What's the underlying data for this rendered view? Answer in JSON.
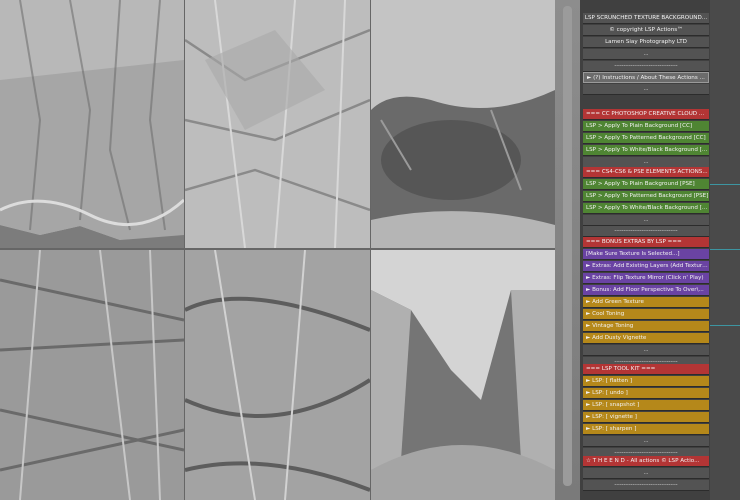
{
  "panel_rows": [
    {
      "text": "LSP SCRUNCHED TEXTURE BACKGROUND...",
      "style": "text"
    },
    {
      "text": "© copyright LSP Actions™",
      "style": "text"
    },
    {
      "text": "Lamen Siay Photography LTD",
      "style": "text"
    },
    {
      "text": "...",
      "style": "dim"
    },
    {
      "text": "-----------------------------------",
      "style": "dim"
    },
    {
      "text": "► (?) Instructions / About These Actions ...",
      "style": "sel"
    },
    {
      "text": "...",
      "style": "dim"
    },
    {
      "text": "=== CC PHOTOSHOP CREATIVE CLOUD ...",
      "style": "red"
    },
    {
      "text": "LSP > Apply To Plain Background [CC]",
      "style": "green"
    },
    {
      "text": "LSP > Apply To Patterned Background [CC]",
      "style": "green"
    },
    {
      "text": "LSP > Apply To White/Black Background [...",
      "style": "green"
    },
    {
      "text": "...",
      "style": "dim"
    },
    {
      "text": "=== CS4-CS6 & PSE ELEMENTS ACTIONS...",
      "style": "red"
    },
    {
      "text": "LSP > Apply To Plain Background [PSE]",
      "style": "green"
    },
    {
      "text": "LSP > Apply To Patterned Background [PSE]",
      "style": "green"
    },
    {
      "text": "LSP > Apply To White/Black Background [...",
      "style": "green"
    },
    {
      "text": "...",
      "style": "dim"
    },
    {
      "text": "-----------------------------------",
      "style": "dim"
    },
    {
      "text": "=== BONUS EXTRAS BY LSP ===",
      "style": "red"
    },
    {
      "text": "[Make Sure Texture Is Selected...]",
      "style": "purple"
    },
    {
      "text": "► Extras: Add Existing Layers (Add Texture...",
      "style": "purple"
    },
    {
      "text": "► Extras: Flip Texture Mirror (Click n' Play)",
      "style": "purple"
    },
    {
      "text": "► Bonus: Add Floor Perspective To Over\\...",
      "style": "purple"
    },
    {
      "text": "► Add Green Texture",
      "style": "gold"
    },
    {
      "text": "► Cool Toning",
      "style": "gold"
    },
    {
      "text": "► Vintage Toning",
      "style": "gold"
    },
    {
      "text": "► Add Dusty Vignette",
      "style": "gold"
    },
    {
      "text": "...",
      "style": "dim"
    },
    {
      "text": "-----------------------------------",
      "style": "dim"
    },
    {
      "text": "=== LSP TOOL KIT ===",
      "style": "red"
    },
    {
      "text": "► LSP: [ flatten ]",
      "style": "gold"
    },
    {
      "text": "► LSP: [ undo ]",
      "style": "gold"
    },
    {
      "text": "► LSP: [ snapshot ]",
      "style": "gold"
    },
    {
      "text": "► LSP: [ vignette ]",
      "style": "gold"
    },
    {
      "text": "► LSP: [ sharpen ]",
      "style": "gold"
    },
    {
      "text": "...",
      "style": "dim"
    },
    {
      "text": "-----------------------------------",
      "style": "dim"
    },
    {
      "text": "☆ T H E  E N D - All actions © LSP Actio...",
      "style": "red"
    },
    {
      "text": "...",
      "style": "dim"
    },
    {
      "text": "-----------------------------------",
      "style": "dim"
    }
  ],
  "colors": {
    "red": "#b33535",
    "green": "#4f8533",
    "purple": "#6a43a3",
    "gold": "#b5881a",
    "guide": "#3aa7b6"
  }
}
